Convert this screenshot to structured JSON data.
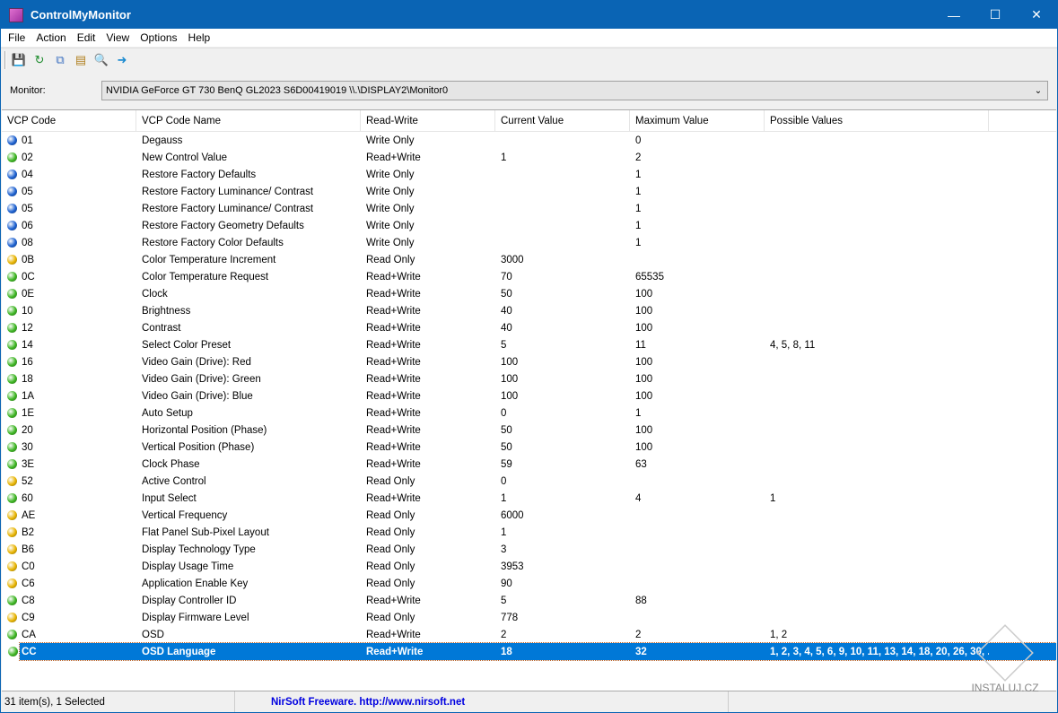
{
  "window": {
    "title": "ControlMyMonitor"
  },
  "menu": [
    "File",
    "Action",
    "Edit",
    "View",
    "Options",
    "Help"
  ],
  "toolbar": [
    "save-icon",
    "refresh-icon",
    "copy-icon",
    "properties-icon",
    "find-icon",
    "exit-icon"
  ],
  "monitor": {
    "label": "Monitor:",
    "value": "NVIDIA GeForce GT 730  BenQ GL2023  S6D00419019  \\\\.\\DISPLAY2\\Monitor0"
  },
  "columns": [
    "VCP Code",
    "VCP Code Name",
    "Read-Write",
    "Current Value",
    "Maximum Value",
    "Possible Values"
  ],
  "status_colors": {
    "Write Only": "#1a5fd0",
    "Read+Write": "#3cb521",
    "Read Only": "#e8b400"
  },
  "rows": [
    [
      "01",
      "Degauss",
      "Write Only",
      "",
      "0",
      ""
    ],
    [
      "02",
      "New Control Value",
      "Read+Write",
      "1",
      "2",
      ""
    ],
    [
      "04",
      "Restore Factory Defaults",
      "Write Only",
      "",
      "1",
      ""
    ],
    [
      "05",
      "Restore Factory Luminance/ Contrast",
      "Write Only",
      "",
      "1",
      ""
    ],
    [
      "05",
      "Restore Factory Luminance/ Contrast",
      "Write Only",
      "",
      "1",
      ""
    ],
    [
      "06",
      "Restore Factory Geometry Defaults",
      "Write Only",
      "",
      "1",
      ""
    ],
    [
      "08",
      "Restore Factory Color Defaults",
      "Write Only",
      "",
      "1",
      ""
    ],
    [
      "0B",
      "Color Temperature Increment",
      "Read Only",
      "3000",
      "",
      ""
    ],
    [
      "0C",
      "Color Temperature Request",
      "Read+Write",
      "70",
      "65535",
      ""
    ],
    [
      "0E",
      "Clock",
      "Read+Write",
      "50",
      "100",
      ""
    ],
    [
      "10",
      "Brightness",
      "Read+Write",
      "40",
      "100",
      ""
    ],
    [
      "12",
      "Contrast",
      "Read+Write",
      "40",
      "100",
      ""
    ],
    [
      "14",
      "Select Color Preset",
      "Read+Write",
      "5",
      "11",
      "4, 5, 8, 11"
    ],
    [
      "16",
      "Video Gain (Drive): Red",
      "Read+Write",
      "100",
      "100",
      ""
    ],
    [
      "18",
      "Video Gain (Drive): Green",
      "Read+Write",
      "100",
      "100",
      ""
    ],
    [
      "1A",
      "Video Gain (Drive): Blue",
      "Read+Write",
      "100",
      "100",
      ""
    ],
    [
      "1E",
      "Auto Setup",
      "Read+Write",
      "0",
      "1",
      ""
    ],
    [
      "20",
      "Horizontal Position (Phase)",
      "Read+Write",
      "50",
      "100",
      ""
    ],
    [
      "30",
      "Vertical Position (Phase)",
      "Read+Write",
      "50",
      "100",
      ""
    ],
    [
      "3E",
      "Clock Phase",
      "Read+Write",
      "59",
      "63",
      ""
    ],
    [
      "52",
      "Active Control",
      "Read Only",
      "0",
      "",
      ""
    ],
    [
      "60",
      "Input Select",
      "Read+Write",
      "1",
      "4",
      "1"
    ],
    [
      "AE",
      "Vertical Frequency",
      "Read Only",
      "6000",
      "",
      ""
    ],
    [
      "B2",
      "Flat Panel Sub-Pixel Layout",
      "Read Only",
      "1",
      "",
      ""
    ],
    [
      "B6",
      "Display Technology Type",
      "Read Only",
      "3",
      "",
      ""
    ],
    [
      "C0",
      "Display Usage Time",
      "Read Only",
      "3953",
      "",
      ""
    ],
    [
      "C6",
      "Application Enable Key",
      "Read Only",
      "90",
      "",
      ""
    ],
    [
      "C8",
      "Display Controller ID",
      "Read+Write",
      "5",
      "88",
      ""
    ],
    [
      "C9",
      "Display Firmware Level",
      "Read Only",
      "778",
      "",
      ""
    ],
    [
      "CA",
      "OSD",
      "Read+Write",
      "2",
      "2",
      "1, 2"
    ],
    [
      "CC",
      "OSD Language",
      "Read+Write",
      "18",
      "32",
      "1, 2, 3, 4, 5, 6, 9, 10, 11, 13, 14, 18, 20, 26, 30, ..."
    ]
  ],
  "selected_index": 30,
  "statusbar": {
    "items": "31 item(s), 1 Selected",
    "credit": "NirSoft Freeware.  http://www.nirsoft.net"
  },
  "watermark": "INSTALUJ.CZ"
}
